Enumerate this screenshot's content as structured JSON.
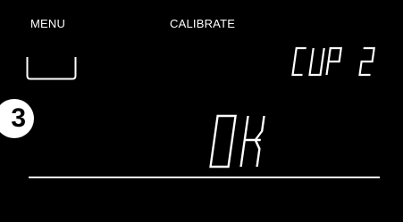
{
  "header": {
    "menu_label": "MENU",
    "mode_label": "CALIBRATE"
  },
  "cup_icon": {
    "icon": "cup-outline-icon"
  },
  "step": {
    "number": "3"
  },
  "cup_indicator": {
    "text": "CUP 2"
  },
  "status": {
    "text": "OK"
  },
  "colors": {
    "background": "#000000",
    "foreground": "#ffffff"
  }
}
